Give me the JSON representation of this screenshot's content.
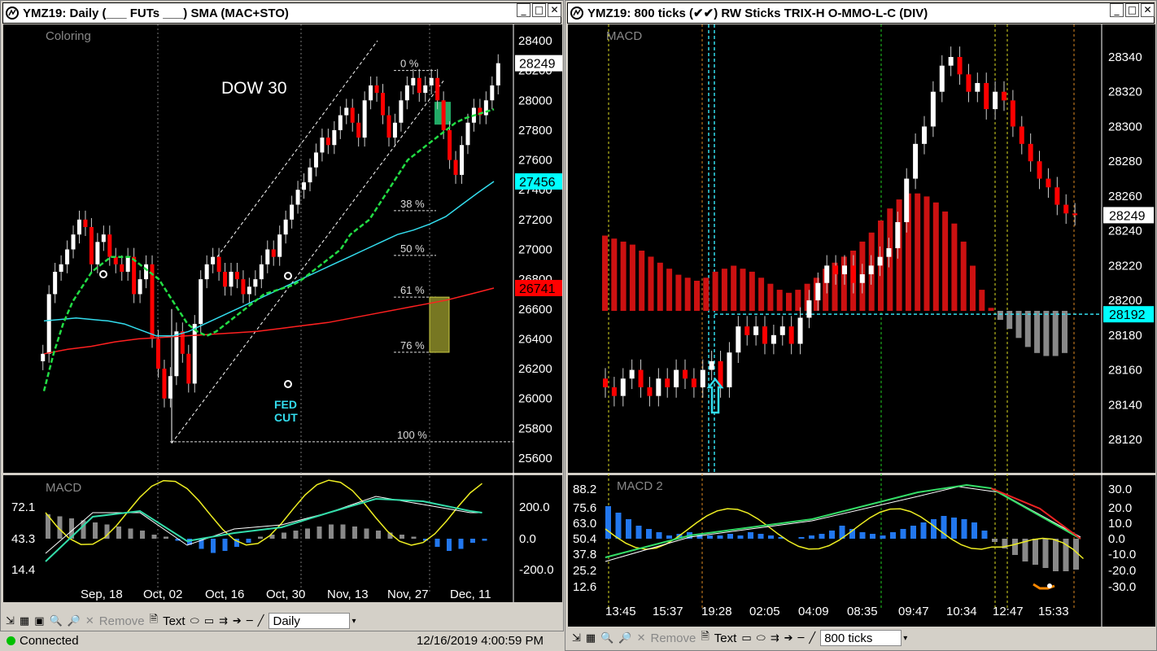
{
  "left": {
    "title": "YMZ19: Daily (___ FUTs ___)  SMA  (MAC+STO)",
    "coloring_label": "Coloring",
    "chart_title": "DOW 30",
    "annotation": [
      "FED",
      "CUT"
    ],
    "price_ticks": [
      "28400",
      "28200",
      "28000",
      "27800",
      "27600",
      "27400",
      "27200",
      "27000",
      "26800",
      "26600",
      "26400",
      "26200",
      "26000",
      "25800",
      "25600"
    ],
    "price_boxes": [
      {
        "label": "28249",
        "value": 28249,
        "bg": "#ffffff",
        "fg": "#000000"
      },
      {
        "label": "27456",
        "value": 27456,
        "bg": "#00ffff",
        "fg": "#000000"
      },
      {
        "label": "26741",
        "value": 26741,
        "bg": "#ff0000",
        "fg": "#000000"
      }
    ],
    "fib_levels": [
      {
        "label": "0 %",
        "value": 28200
      },
      {
        "label": "38 %",
        "value": 27260
      },
      {
        "label": "50 %",
        "value": 26960
      },
      {
        "label": "61 %",
        "value": 26680
      },
      {
        "label": "76 %",
        "value": 26310
      },
      {
        "label": "100 %",
        "value": 25710
      }
    ],
    "macd_label": "MACD",
    "macd_left_ticks": [
      "72.1",
      "43.3",
      "14.4"
    ],
    "macd_right_ticks": [
      "200.0",
      "0.0",
      "-200.0"
    ],
    "date_ticks": [
      "Sep, 18",
      "Oct, 02",
      "Oct, 16",
      "Oct, 30",
      "Nov, 13",
      "Nov, 27",
      "Dec, 11"
    ],
    "toolbar": {
      "remove": "Remove",
      "text": "Text",
      "interval": "Daily"
    }
  },
  "right": {
    "title": "YMZ19: 800 ticks (✔✔) RW Sticks TRIX-H O-MMO-L-C (DIV)",
    "macd_label": "MACD",
    "price_ticks": [
      "28340",
      "28320",
      "28300",
      "28280",
      "28260",
      "28240",
      "28220",
      "28200",
      "28180",
      "28160",
      "28140",
      "28120"
    ],
    "price_boxes": [
      {
        "label": "28249",
        "value": 28249,
        "bg": "#ffffff",
        "fg": "#000000"
      },
      {
        "label": "28192",
        "value": 28192,
        "bg": "#00ffff",
        "fg": "#000000"
      }
    ],
    "macd2_label": "MACD 2",
    "macd2_left_ticks": [
      "88.2",
      "75.6",
      "63.0",
      "50.4",
      "37.8",
      "25.2",
      "12.6"
    ],
    "macd2_right_ticks": [
      "30.0",
      "20.0",
      "10.0",
      "0.0",
      "-10.0",
      "-20.0",
      "-30.0"
    ],
    "time_ticks": [
      "13:45",
      "15:37",
      "19:28",
      "02:05",
      "04:09",
      "08:35",
      "09:47",
      "10:34",
      "12:47",
      "15:33"
    ],
    "toolbar": {
      "remove": "Remove",
      "text": "Text",
      "interval": "800 ticks"
    }
  },
  "status": {
    "connection": "Connected",
    "datetime": "12/16/2019 4:00:59 PM"
  },
  "chart_data": [
    {
      "type": "candlestick",
      "name": "YMZ19 Daily",
      "ylim": [
        25600,
        28400
      ],
      "x_ticks": [
        "Sep, 18",
        "Oct, 02",
        "Oct, 16",
        "Oct, 30",
        "Nov, 13",
        "Nov, 27",
        "Dec, 11"
      ],
      "close": [
        26300,
        26700,
        26850,
        26900,
        27000,
        27100,
        27200,
        27150,
        26900,
        27050,
        27100,
        26950,
        26900,
        26850,
        26950,
        26700,
        26800,
        26900,
        26400,
        26200,
        26000,
        26150,
        26450,
        26300,
        26100,
        26500,
        26800,
        26900,
        26950,
        26850,
        26750,
        26850,
        26800,
        26700,
        26750,
        26800,
        26900,
        27000,
        26950,
        27100,
        27200,
        27300,
        27400,
        27450,
        27550,
        27650,
        27750,
        27700,
        27800,
        27900,
        27950,
        27850,
        27750,
        28000,
        28100,
        28050,
        27900,
        27750,
        27850,
        28000,
        28100,
        28150,
        28050,
        28100,
        28150,
        28000,
        27800,
        27600,
        27500,
        27700,
        27850,
        27950,
        27900,
        28000,
        28100,
        28249
      ],
      "sma_green": [
        26050,
        26300,
        26500,
        26650,
        26750,
        26850,
        26900,
        26950,
        26950,
        26950,
        26900,
        26850,
        26800,
        26700,
        26600,
        26500,
        26450,
        26420,
        26450,
        26500,
        26550,
        26600,
        26650,
        26700,
        26720,
        26740,
        26760,
        26800,
        26850,
        26900,
        26950,
        27000,
        27100,
        27150,
        27200,
        27300,
        27400,
        27500,
        27600,
        27650,
        27700,
        27750,
        27800,
        27850,
        27880,
        27900,
        27920,
        27940
      ],
      "sma_cyan": [
        26520,
        26530,
        26540,
        26530,
        26520,
        26500,
        26460,
        26420,
        26420,
        26450,
        26500,
        26550,
        26600,
        26650,
        26700,
        26750,
        26800,
        26850,
        26900,
        26950,
        27000,
        27050,
        27100,
        27130,
        27170,
        27220,
        27300,
        27380,
        27456
      ],
      "sma_red": [
        26300,
        26330,
        26350,
        26380,
        26400,
        26410,
        26420,
        26430,
        26440,
        26450,
        26470,
        26490,
        26510,
        26540,
        26570,
        26600,
        26630,
        26660,
        26700,
        26741
      ]
    },
    {
      "type": "candlestick",
      "name": "YMZ19 800 ticks",
      "ylim": [
        28110,
        28350
      ],
      "x_ticks": [
        "13:45",
        "15:37",
        "19:28",
        "02:05",
        "04:09",
        "08:35",
        "09:47",
        "10:34",
        "12:47",
        "15:33"
      ],
      "close": [
        28150,
        28145,
        28155,
        28160,
        28150,
        28145,
        28155,
        28150,
        28160,
        28155,
        28150,
        28160,
        28165,
        28150,
        28170,
        28185,
        28180,
        28185,
        28175,
        28180,
        28185,
        28175,
        28190,
        28200,
        28210,
        28220,
        28215,
        28220,
        28210,
        28215,
        28220,
        28225,
        28230,
        28245,
        28270,
        28290,
        28300,
        28320,
        28335,
        28340,
        28330,
        28320,
        28325,
        28310,
        28320,
        28315,
        28300,
        28290,
        28280,
        28270,
        28265,
        28255,
        28250,
        28249
      ],
      "macd_hist": [
        50,
        48,
        46,
        44,
        40,
        36,
        32,
        28,
        24,
        22,
        20,
        22,
        26,
        28,
        30,
        28,
        26,
        22,
        18,
        14,
        12,
        14,
        18,
        22,
        28,
        32,
        36,
        40,
        46,
        52,
        60,
        68,
        74,
        78,
        78,
        76,
        72,
        66,
        58,
        46,
        30,
        14,
        2,
        -6,
        -12,
        -18,
        -24,
        -28,
        -30,
        -30,
        -28
      ]
    },
    {
      "type": "line",
      "name": "MACD (daily)",
      "left_ylim": [
        14.4,
        72.1
      ],
      "right_ylim": [
        -200,
        200
      ]
    },
    {
      "type": "line",
      "name": "MACD 2 (ticks)",
      "left_ylim": [
        12.6,
        88.2
      ],
      "right_ylim": [
        -30,
        30
      ]
    }
  ]
}
